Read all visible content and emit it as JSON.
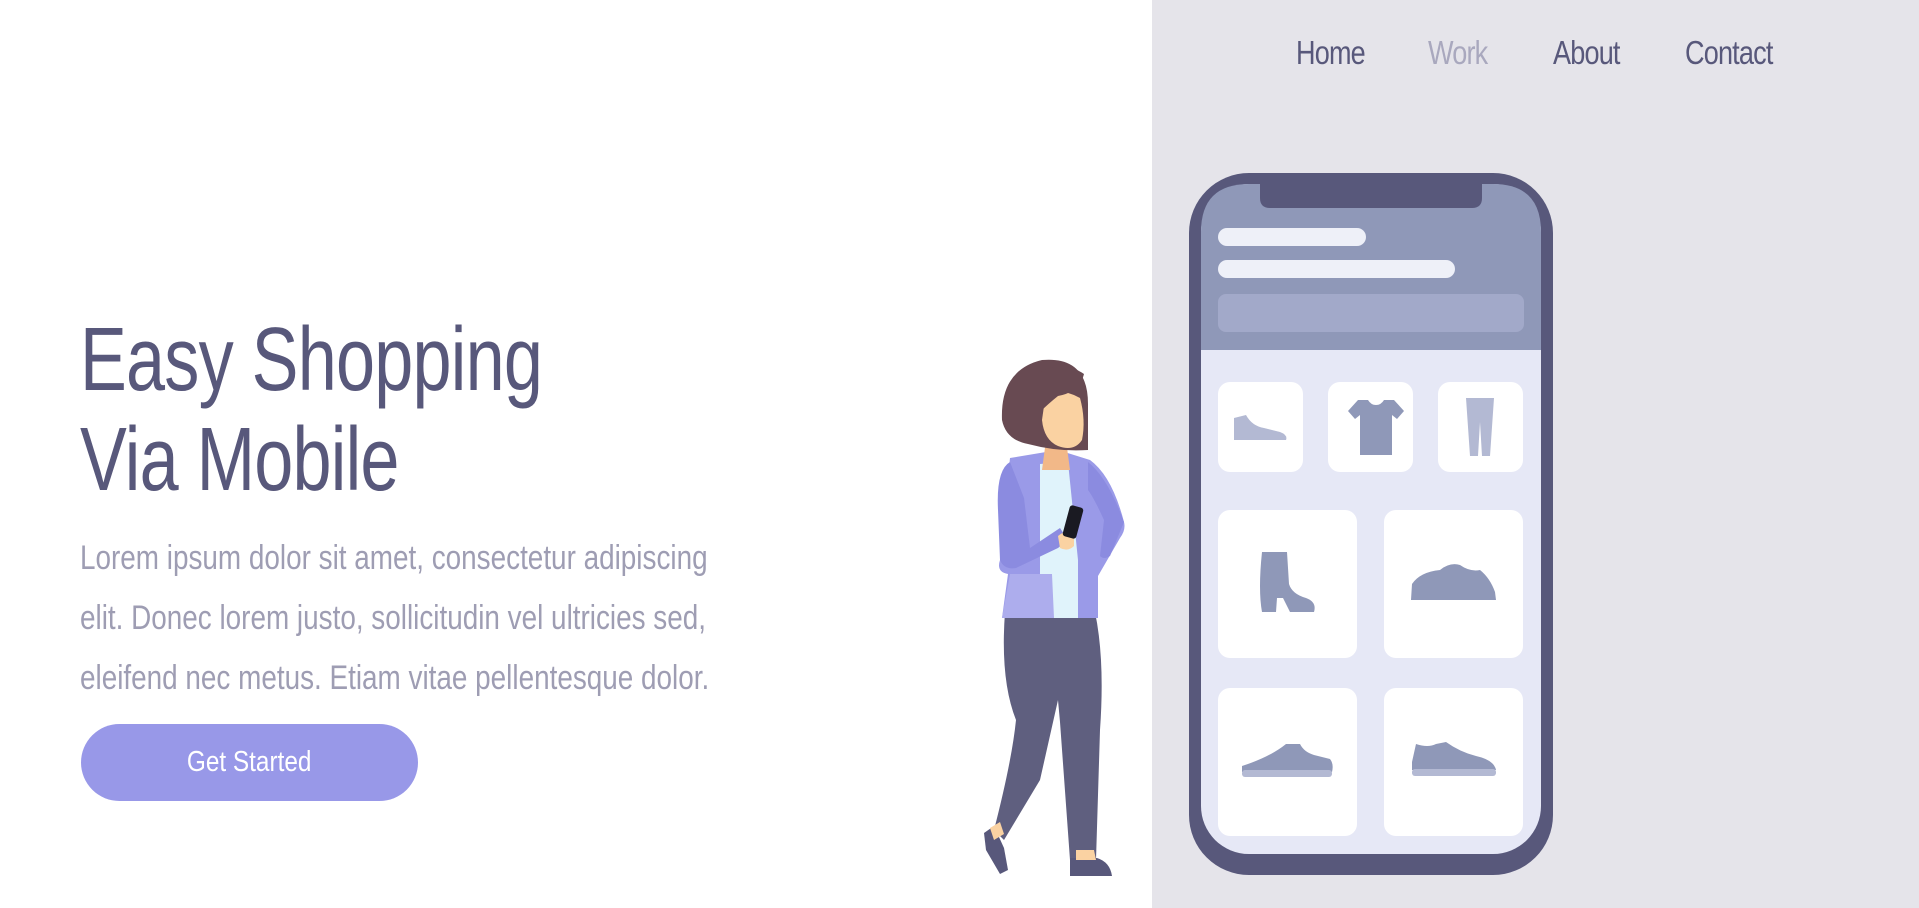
{
  "nav": {
    "items": [
      {
        "label": "Home"
      },
      {
        "label": "Work"
      },
      {
        "label": "About"
      },
      {
        "label": "Contact"
      }
    ]
  },
  "hero": {
    "title_line1": "Easy Shopping",
    "title_line2": "Via Mobile",
    "body_lines": [
      "Lorem ipsum dolor sit amet, consectetur adipiscing",
      "elit. Donec lorem justo, sollicitudin vel ultricies sed,",
      "eleifend nec metus. Etiam vitae pellentesque dolor."
    ],
    "cta_label": "Get Started"
  },
  "illustration": {
    "phone_products": [
      "shoe-icon",
      "tshirt-icon",
      "pants-icon",
      "boot-icon",
      "sneaker-icon",
      "sneaker-icon",
      "sneaker-icon"
    ],
    "colors": {
      "accent": "#9898e8",
      "dark": "#58587b",
      "panel": "#e5e4ea"
    }
  }
}
